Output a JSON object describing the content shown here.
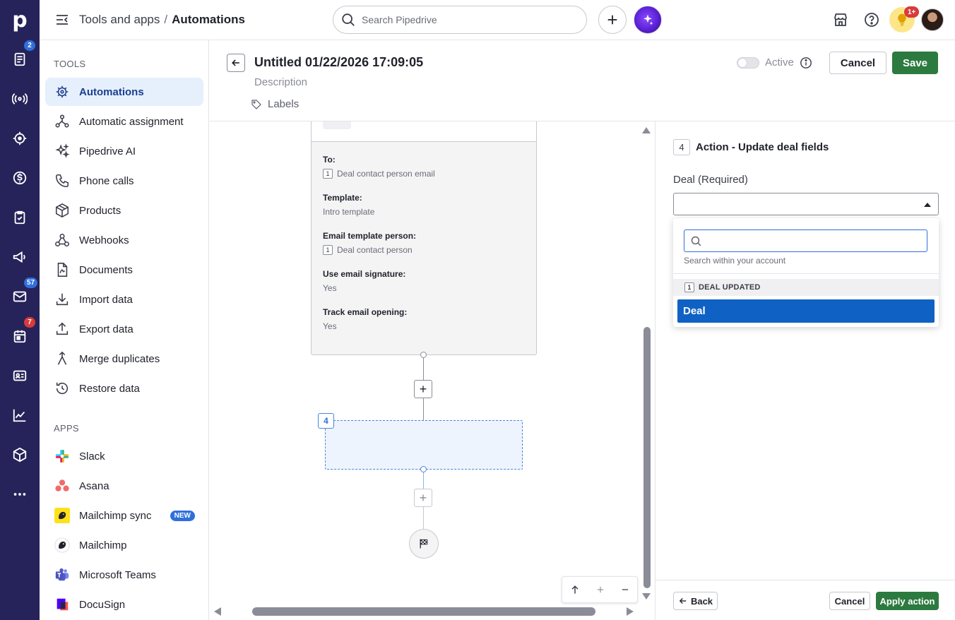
{
  "rail": {
    "logo": "p",
    "badges": {
      "leads": "2",
      "mail": "57",
      "calendar": "7"
    }
  },
  "topbar": {
    "breadcrumb_parent": "Tools and apps",
    "breadcrumb_sep": "/",
    "breadcrumb_current": "Automations",
    "search_placeholder": "Search Pipedrive",
    "notifications_badge": "1+"
  },
  "sidebar": {
    "tools_title": "TOOLS",
    "tools": [
      {
        "label": "Automations",
        "icon": "automations-icon",
        "active": true
      },
      {
        "label": "Automatic assignment",
        "icon": "assignment-icon"
      },
      {
        "label": "Pipedrive AI",
        "icon": "sparkle-icon"
      },
      {
        "label": "Phone calls",
        "icon": "phone-icon"
      },
      {
        "label": "Products",
        "icon": "box-icon"
      },
      {
        "label": "Webhooks",
        "icon": "webhook-icon"
      },
      {
        "label": "Documents",
        "icon": "document-icon"
      },
      {
        "label": "Import data",
        "icon": "download-icon"
      },
      {
        "label": "Export data",
        "icon": "upload-icon"
      },
      {
        "label": "Merge duplicates",
        "icon": "merge-icon"
      },
      {
        "label": "Restore data",
        "icon": "restore-icon"
      }
    ],
    "apps_title": "APPS",
    "apps": [
      {
        "label": "Slack",
        "icon": "slack-icon"
      },
      {
        "label": "Asana",
        "icon": "asana-icon"
      },
      {
        "label": "Mailchimp sync",
        "icon": "mailchimp-icon",
        "badge": "NEW"
      },
      {
        "label": "Mailchimp",
        "icon": "mailchimp-icon"
      },
      {
        "label": "Microsoft Teams",
        "icon": "teams-icon"
      },
      {
        "label": "DocuSign",
        "icon": "docusign-icon"
      }
    ]
  },
  "editor": {
    "title": "Untitled 01/22/2026 17:09:05",
    "description": "Description",
    "labels": "Labels",
    "active_label": "Active",
    "cancel": "Cancel",
    "save": "Save"
  },
  "canvas": {
    "card_fields": [
      {
        "label": "To:",
        "value": "Deal contact person email",
        "chip": "1"
      },
      {
        "label": "Template:",
        "value": "Intro template"
      },
      {
        "label": "Email template person:",
        "value": "Deal contact person",
        "chip": "1"
      },
      {
        "label": "Use email signature:",
        "value": "Yes"
      },
      {
        "label": "Track email opening:",
        "value": "Yes"
      }
    ],
    "new_node_number": "4",
    "plus": "+"
  },
  "panel": {
    "step_number": "4",
    "title": "Action - Update deal fields",
    "field_label": "Deal (Required)",
    "dropdown": {
      "search_value": "",
      "hint": "Search within your account",
      "group_chip": "1",
      "group_label": "DEAL UPDATED",
      "option": "Deal"
    },
    "back": "Back",
    "cancel": "Cancel",
    "apply": "Apply action"
  },
  "colors": {
    "rail": "#26235a",
    "accent_blue": "#2f6fdb",
    "save_green": "#2c7a3f",
    "selected_option": "#0f62c4"
  }
}
